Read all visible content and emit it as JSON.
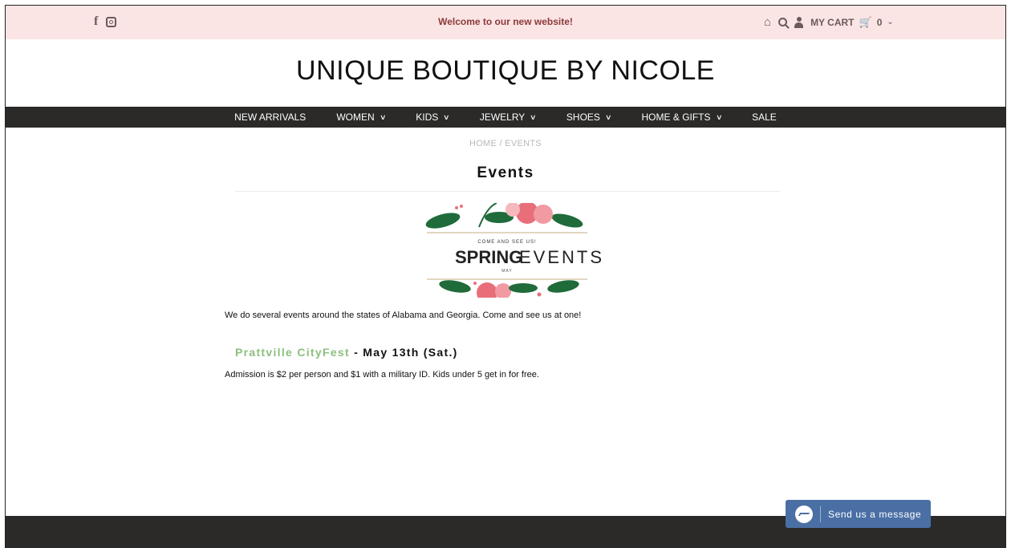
{
  "topbar": {
    "announcement": "Welcome to our new website!",
    "social_icons": [
      "facebook-icon",
      "instagram-icon"
    ],
    "utility": {
      "cart_label": "MY CART",
      "cart_count": "0"
    }
  },
  "logo": "UNIQUE BOUTIQUE BY NICOLE",
  "nav": {
    "items": [
      {
        "label": "NEW ARRIVALS",
        "dropdown": false
      },
      {
        "label": "WOMEN",
        "dropdown": true
      },
      {
        "label": "KIDS",
        "dropdown": true
      },
      {
        "label": "JEWELRY",
        "dropdown": true
      },
      {
        "label": "SHOES",
        "dropdown": true
      },
      {
        "label": "HOME & GIFTS",
        "dropdown": true
      },
      {
        "label": "SALE",
        "dropdown": false
      }
    ]
  },
  "breadcrumb": "HOME / EVENTS",
  "page_title": "Events",
  "banner": {
    "kicker": "COME AND SEE US!",
    "title_bold": "SPRING",
    "title_light": "EVENTS",
    "subtitle": "MAY"
  },
  "intro": "We do several events around the states of Alabama and Georgia. Come and see us at one!",
  "event": {
    "link": "Prattville CityFest",
    "date": " - May 13th (Sat.)",
    "description": "Admission is $2 per person and $1 with a military ID. Kids under 5 get in for free."
  },
  "messenger": {
    "label": "Send us a message"
  },
  "colors": {
    "topbar_bg": "#fbe4e4",
    "nav_bg": "#2b2a29",
    "event_link": "#8cc07e",
    "messenger": "#4a6fa5"
  }
}
